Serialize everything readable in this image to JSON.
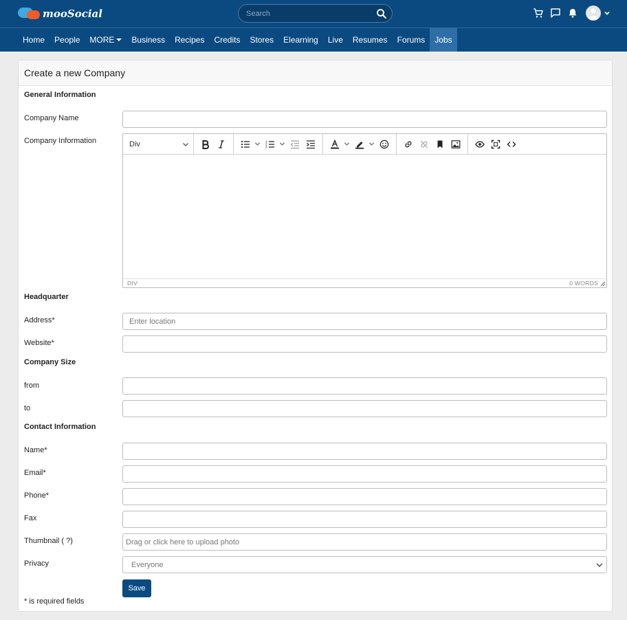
{
  "header": {
    "logo_text": "mooSocial",
    "search_placeholder": "Search"
  },
  "nav": {
    "items": [
      "Home",
      "People",
      "MORE",
      "Business",
      "Recipes",
      "Credits",
      "Stores",
      "Elearning",
      "Live",
      "Resumes",
      "Forums",
      "Jobs"
    ],
    "active": "Jobs"
  },
  "page": {
    "title": "Create a new Company",
    "sections": {
      "general": "General Information",
      "headquarter": "Headquarter",
      "company_size": "Company Size",
      "contact": "Contact Information"
    },
    "labels": {
      "company_name": "Company Name",
      "company_info": "Company Information",
      "address": "Address*",
      "website": "Website*",
      "from": "from",
      "to": "to",
      "name": "Name*",
      "email": "Email*",
      "phone": "Phone*",
      "fax": "Fax",
      "thumbnail": "Thumbnail ( ?)",
      "privacy": "Privacy"
    },
    "placeholders": {
      "address": "Enter location",
      "thumbnail": "Drag or click here to upload photo"
    },
    "editor": {
      "block_format": "Div",
      "status_path": "DIV",
      "word_count": "0 WORDS"
    },
    "privacy_value": "Everyone",
    "save_label": "Save",
    "required_note": "* is required fields"
  },
  "colors": {
    "header_bg": "#0a4a80",
    "active_nav": "#2e6ea6",
    "save_button": "#0a4a80"
  }
}
